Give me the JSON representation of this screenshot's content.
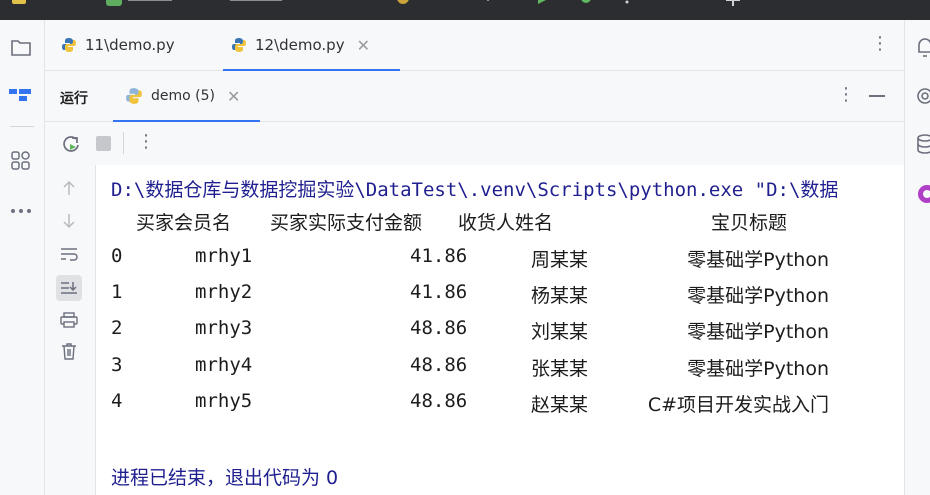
{
  "titlebar": {
    "items": [
      "demo (5)"
    ]
  },
  "editor_tabs": [
    {
      "label": "11\\demo.py",
      "active": false
    },
    {
      "label": "12\\demo.py",
      "active": true
    }
  ],
  "run_window": {
    "label": "运行",
    "tab_label": "demo (5)"
  },
  "console": {
    "command_line": "D:\\数据仓库与数据挖掘实验\\DataTest\\.venv\\Scripts\\python.exe \"D:\\数据",
    "headers": [
      "买家会员名",
      "买家实际支付金额",
      "收货人姓名",
      "宝贝标题"
    ],
    "rows": [
      {
        "index": "0",
        "member": "mrhy1",
        "amount": "41.86",
        "receiver": "周某某",
        "title": "零基础学Python"
      },
      {
        "index": "1",
        "member": "mrhy2",
        "amount": "41.86",
        "receiver": "杨某某",
        "title": "零基础学Python"
      },
      {
        "index": "2",
        "member": "mrhy3",
        "amount": "48.86",
        "receiver": "刘某某",
        "title": "零基础学Python"
      },
      {
        "index": "3",
        "member": "mrhy4",
        "amount": "48.86",
        "receiver": "张某某",
        "title": "零基础学Python"
      },
      {
        "index": "4",
        "member": "mrhy5",
        "amount": "48.86",
        "receiver": "赵某某",
        "title": "C#项目开发实战入门"
      }
    ],
    "exit_message": "进程已结束，退出代码为 0"
  },
  "colors": {
    "accent": "#3574f0",
    "console_text": "#1f1f8f",
    "python_blue": "#3b76b4",
    "python_yellow": "#f0c33c"
  }
}
